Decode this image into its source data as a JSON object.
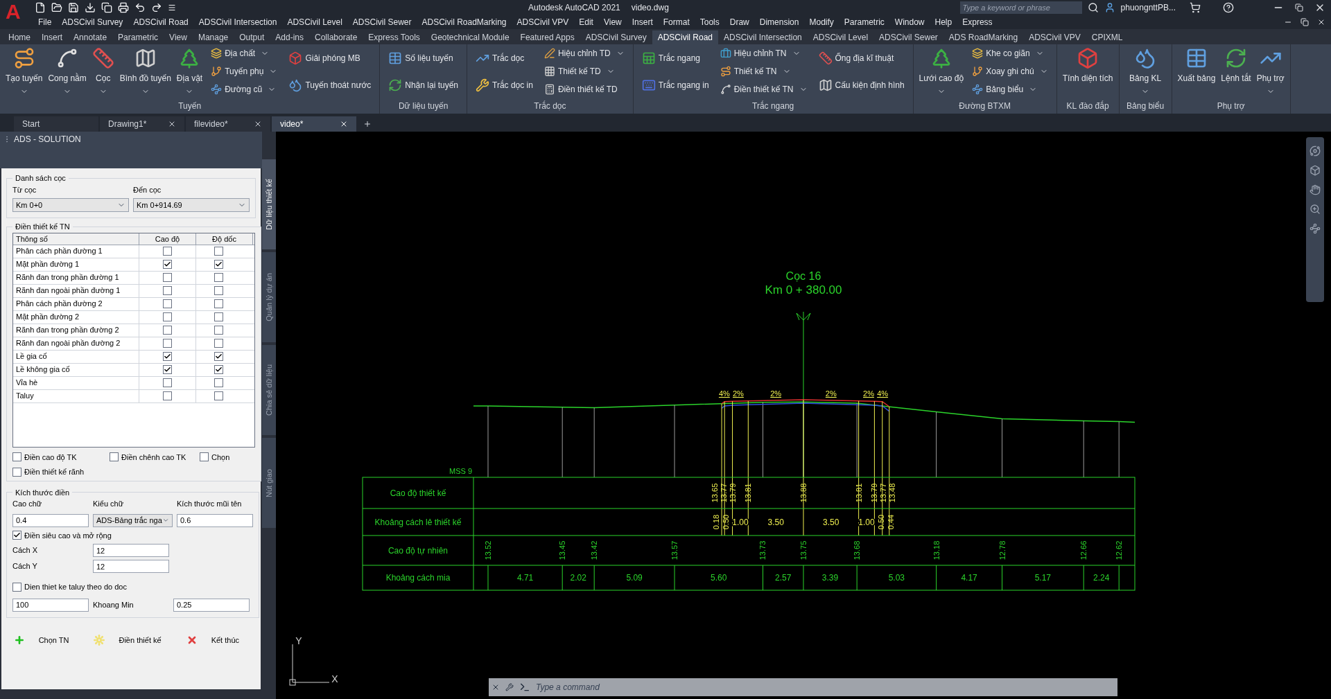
{
  "title_bar": {
    "logo": "A",
    "app_title": "Autodesk AutoCAD 2021",
    "file_name": "video.dwg",
    "search": {
      "placeholder": "Type a keyword or phrase"
    },
    "user": "phuongnttPB..."
  },
  "menu": [
    "File",
    "ADSCivil Survey",
    "ADSCivil Road",
    "ADSCivil Intersection",
    "ADSCivil Level",
    "ADSCivil Sewer",
    "ADSCivil RoadMarking",
    "ADSCivil VPV",
    "Edit",
    "View",
    "Insert",
    "Format",
    "Tools",
    "Draw",
    "Dimension",
    "Modify",
    "Parametric",
    "Window",
    "Help",
    "Express"
  ],
  "ribbon_tabs": [
    {
      "label": "Home",
      "selected": false
    },
    {
      "label": "Insert",
      "selected": false
    },
    {
      "label": "Annotate",
      "selected": false
    },
    {
      "label": "Parametric",
      "selected": false
    },
    {
      "label": "View",
      "selected": false
    },
    {
      "label": "Manage",
      "selected": false
    },
    {
      "label": "Output",
      "selected": false
    },
    {
      "label": "Add-ins",
      "selected": false
    },
    {
      "label": "Collaborate",
      "selected": false
    },
    {
      "label": "Express Tools",
      "selected": false
    },
    {
      "label": "Geotechnical Module",
      "selected": false
    },
    {
      "label": "Featured Apps",
      "selected": false
    },
    {
      "label": "ADSCivil Survey",
      "selected": false
    },
    {
      "label": "ADSCivil Road",
      "selected": true
    },
    {
      "label": "ADSCivil Intersection",
      "selected": false
    },
    {
      "label": "ADSCivil Level",
      "selected": false
    },
    {
      "label": "ADSCivil Sewer",
      "selected": false
    },
    {
      "label": "ADS RoadMarking",
      "selected": false
    },
    {
      "label": "ADSCivil VPV",
      "selected": false
    },
    {
      "label": "CPIXML",
      "selected": false
    }
  ],
  "ribbon_panels": [
    {
      "title": "Tuyến",
      "groups": [
        {
          "kind": "large",
          "items": [
            {
              "label": "Tạo tuyến",
              "dropdown": true
            }
          ]
        },
        {
          "kind": "large",
          "items": [
            {
              "label": "Cong nằm",
              "dropdown": true
            }
          ]
        },
        {
          "kind": "large",
          "items": [
            {
              "label": "Cọc",
              "dropdown": true
            }
          ]
        },
        {
          "kind": "large",
          "items": [
            {
              "label": "Bình đồ tuyến",
              "dropdown": true
            }
          ]
        },
        {
          "kind": "large",
          "items": [
            {
              "label": "Địa vật",
              "dropdown": true
            }
          ]
        },
        {
          "kind": "stack",
          "items": [
            {
              "label": "Địa chất",
              "dropdown": true
            },
            {
              "label": "Tuyến phụ",
              "dropdown": true
            },
            {
              "label": "Đường cũ",
              "dropdown": true
            }
          ]
        },
        {
          "kind": "medium",
          "items": [
            {
              "label": "Giải phóng MB",
              "dropdown": false
            },
            {
              "label": "Tuyến thoát nước",
              "dropdown": false
            }
          ]
        }
      ]
    },
    {
      "title": "Dữ liệu tuyến",
      "groups": [
        {
          "kind": "medium",
          "items": [
            {
              "label": "Số liệu tuyến",
              "dropdown": false
            },
            {
              "label": "Nhận lại tuyến",
              "dropdown": false
            }
          ]
        }
      ]
    },
    {
      "title": "Trắc dọc",
      "groups": [
        {
          "kind": "medium",
          "items": [
            {
              "label": "Trắc dọc",
              "dropdown": false
            },
            {
              "label": "Trắc dọc in",
              "dropdown": false
            }
          ]
        },
        {
          "kind": "stack",
          "items": [
            {
              "label": "Hiệu chỉnh TD",
              "dropdown": true
            },
            {
              "label": "Thiết kế TD",
              "dropdown": true
            },
            {
              "label": "Điền thiết kế TD",
              "dropdown": false
            }
          ]
        }
      ]
    },
    {
      "title": "Trắc ngang",
      "groups": [
        {
          "kind": "medium",
          "items": [
            {
              "label": "Trắc ngang",
              "dropdown": false
            },
            {
              "label": "Trắc ngang in",
              "dropdown": false
            }
          ]
        },
        {
          "kind": "stack",
          "items": [
            {
              "label": "Hiệu chỉnh TN",
              "dropdown": true
            },
            {
              "label": "Thiết kế TN",
              "dropdown": true
            },
            {
              "label": "Điền thiết kế TN",
              "dropdown": true
            }
          ]
        },
        {
          "kind": "medium",
          "items": [
            {
              "label": "Ống địa kĩ thuật",
              "dropdown": false
            },
            {
              "label": "Cấu kiện định hình",
              "dropdown": false
            }
          ]
        }
      ]
    },
    {
      "title": "Đường BTXM",
      "groups": [
        {
          "kind": "large",
          "items": [
            {
              "label": "Lưới cao độ",
              "dropdown": true
            }
          ]
        },
        {
          "kind": "stack",
          "items": [
            {
              "label": "Khe co giãn",
              "dropdown": true
            },
            {
              "label": "Xoay ghi chú",
              "dropdown": true
            },
            {
              "label": "Bảng biểu",
              "dropdown": true
            }
          ]
        }
      ]
    },
    {
      "title": "KL đào đắp",
      "groups": [
        {
          "kind": "large",
          "items": [
            {
              "label": "Tính diện tích",
              "dropdown": false
            }
          ]
        }
      ]
    },
    {
      "title": "Bảng biểu",
      "groups": [
        {
          "kind": "large",
          "items": [
            {
              "label": "Bảng KL",
              "dropdown": true
            }
          ]
        }
      ]
    },
    {
      "title": "Phụ trợ",
      "groups": [
        {
          "kind": "large",
          "items": [
            {
              "label": "Xuất bảng",
              "dropdown": false
            }
          ]
        },
        {
          "kind": "large",
          "items": [
            {
              "label": "Lệnh tắt",
              "dropdown": false
            }
          ]
        },
        {
          "kind": "large",
          "items": [
            {
              "label": "Phụ trợ",
              "dropdown": true
            }
          ]
        }
      ]
    }
  ],
  "file_tabs": [
    {
      "label": "Start",
      "selected": false,
      "closable": false
    },
    {
      "label": "Drawing1*",
      "selected": false,
      "closable": true
    },
    {
      "label": "filevideo*",
      "selected": false,
      "closable": true
    },
    {
      "label": "video*",
      "selected": true,
      "closable": true
    }
  ],
  "palette": {
    "title": "ADS - SOLUTION",
    "side_tabs": [
      {
        "label": "Dữ liệu thiết kế",
        "selected": true
      },
      {
        "label": "Quản lý dự án",
        "selected": false
      },
      {
        "label": "Chia sẻ dữ liệu",
        "selected": false
      },
      {
        "label": "Nút giao",
        "selected": false
      }
    ],
    "stake_list": {
      "title": "Danh sách cọc",
      "from": {
        "label": "Từ cọc",
        "value": "Km 0+0"
      },
      "to": {
        "label": "Đến cọc",
        "value": "Km 0+914.69"
      }
    },
    "fill_design": {
      "title": "Điền thiết kế TN",
      "columns": [
        "Thông số",
        "Cao độ",
        "Độ dốc"
      ],
      "rows": [
        {
          "name": "Phân cách phần đường 1",
          "elevation": false,
          "slope": false
        },
        {
          "name": "Mặt phần đường 1",
          "elevation": true,
          "slope": true
        },
        {
          "name": "Rãnh đan trong phần đường 1",
          "elevation": false,
          "slope": false
        },
        {
          "name": "Rãnh đan ngoài phần đường 1",
          "elevation": false,
          "slope": false
        },
        {
          "name": "Phân cách phần đường 2",
          "elevation": false,
          "slope": false
        },
        {
          "name": "Mặt phần đường 2",
          "elevation": false,
          "slope": false
        },
        {
          "name": "Rãnh đan trong phần đường 2",
          "elevation": false,
          "slope": false
        },
        {
          "name": "Rãnh đan ngoài phần đường 2",
          "elevation": false,
          "slope": false
        },
        {
          "name": "Lề gia cố",
          "elevation": true,
          "slope": true
        },
        {
          "name": "Lề không gia cố",
          "elevation": true,
          "slope": true
        },
        {
          "name": "Vỉa hè",
          "elevation": false,
          "slope": false
        },
        {
          "name": "Taluy",
          "elevation": false,
          "slope": false
        }
      ],
      "options": [
        {
          "label": "Điền cao độ TK",
          "checked": false
        },
        {
          "label": "Điền chênh cao TK",
          "checked": false
        },
        {
          "label": "Chọn",
          "checked": false
        },
        {
          "label": "Điền thiết kế rãnh",
          "checked": false
        }
      ]
    },
    "sizes": {
      "title": "Kích thước điền",
      "text_height": {
        "label": "Cao chữ",
        "value": "0.4"
      },
      "text_style": {
        "label": "Kiểu chữ",
        "value": "ADS-Bảng trắc nga"
      },
      "arrow_size": {
        "label": "Kích thước mũi tên",
        "value": "0.6"
      },
      "superelevation": {
        "label": "Điền siêu cao và mở rộng",
        "checked": true
      },
      "offset_x": {
        "label": "Cách X",
        "value": "12"
      },
      "offset_y": {
        "label": "Cách Y",
        "value": "12"
      },
      "taluy": {
        "label": "Dien thiet ke taluy theo do doc",
        "checked": false
      },
      "taluy_value": "100",
      "min_gap": {
        "label": "Khoang Min",
        "value": "0.25"
      }
    },
    "actions": [
      "Chọn TN",
      "Điền thiết kế",
      "Kết thúc"
    ]
  },
  "section": {
    "stake": "Cọc 16",
    "chainage": "Km 0 + 380.00",
    "datum": "MSS 9",
    "row_labels": [
      "Cao độ thiết kế",
      "Khoảng cách lẻ thiết kế",
      "Cao độ tự nhiên",
      "Khoảng cách mia"
    ],
    "design_elevations": [
      "13.65",
      "13.77",
      "13.79",
      "13.81",
      "13.88",
      "13.81",
      "13.79",
      "13.77",
      "13.48"
    ],
    "design_offsets": [
      "0.18",
      "0.50",
      "1.00",
      "3.50",
      "3.50",
      "1.00",
      "0.50",
      "0.44"
    ],
    "slopes": [
      "4%",
      "2%",
      "2%",
      "2%",
      "2%",
      "4%"
    ],
    "natural_elevations": [
      "13.52",
      "13.45",
      "13.42",
      "13.57",
      "13.73",
      "13.75",
      "13.68",
      "13.18",
      "12.78",
      "12.66",
      "12.62"
    ],
    "stake_distances": [
      "4.71",
      "2.02",
      "5.09",
      "5.60",
      "2.57",
      "3.39",
      "5.03",
      "4.17",
      "5.17",
      "2.24"
    ]
  },
  "ucs": {
    "x": "X",
    "y": "Y"
  },
  "command_line": {
    "placeholder": "Type a command"
  }
}
